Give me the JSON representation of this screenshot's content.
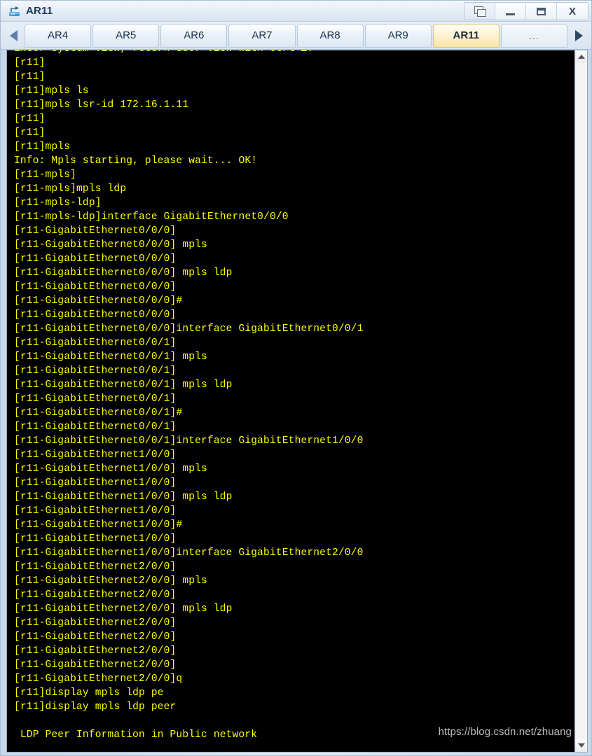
{
  "window": {
    "title": "AR11",
    "icon": "router-icon",
    "controls": [
      {
        "name": "restore-button",
        "glyph": "restore-icon",
        "label": ""
      },
      {
        "name": "minimize-button",
        "glyph": "minimize-icon",
        "label": ""
      },
      {
        "name": "maximize-button",
        "glyph": "maximize-icon",
        "label": ""
      },
      {
        "name": "close-button",
        "glyph": "close-icon",
        "label": "X"
      }
    ]
  },
  "tabbar": {
    "scroll_left_icon": "chevron-left-icon",
    "scroll_right_icon": "chevron-right-icon",
    "active_tab": "AR11",
    "tabs": [
      {
        "label": "AR4",
        "active": false
      },
      {
        "label": "AR5",
        "active": false
      },
      {
        "label": "AR6",
        "active": false
      },
      {
        "label": "AR7",
        "active": false
      },
      {
        "label": "AR8",
        "active": false
      },
      {
        "label": "AR9",
        "active": false
      },
      {
        "label": "AR11",
        "active": true
      },
      {
        "label": "...",
        "active": false
      }
    ]
  },
  "terminal": {
    "foreground_color": "#ffff00",
    "background_color": "#000000",
    "watermark": "https://blog.csdn.net/zhuang",
    "lines": [
      "Enter system view, return user view with Ctrl+Z.",
      "[r11]",
      "[r11]",
      "[r11]mpls ls",
      "[r11]mpls lsr-id 172.16.1.11",
      "[r11]",
      "[r11]",
      "[r11]mpls",
      "Info: Mpls starting, please wait... OK!",
      "[r11-mpls]",
      "[r11-mpls]mpls ldp",
      "[r11-mpls-ldp]",
      "[r11-mpls-ldp]interface GigabitEthernet0/0/0",
      "[r11-GigabitEthernet0/0/0]",
      "[r11-GigabitEthernet0/0/0] mpls",
      "[r11-GigabitEthernet0/0/0]",
      "[r11-GigabitEthernet0/0/0] mpls ldp",
      "[r11-GigabitEthernet0/0/0]",
      "[r11-GigabitEthernet0/0/0]#",
      "[r11-GigabitEthernet0/0/0]",
      "[r11-GigabitEthernet0/0/0]interface GigabitEthernet0/0/1",
      "[r11-GigabitEthernet0/0/1]",
      "[r11-GigabitEthernet0/0/1] mpls",
      "[r11-GigabitEthernet0/0/1]",
      "[r11-GigabitEthernet0/0/1] mpls ldp",
      "[r11-GigabitEthernet0/0/1]",
      "[r11-GigabitEthernet0/0/1]#",
      "[r11-GigabitEthernet0/0/1]",
      "[r11-GigabitEthernet0/0/1]interface GigabitEthernet1/0/0",
      "[r11-GigabitEthernet1/0/0]",
      "[r11-GigabitEthernet1/0/0] mpls",
      "[r11-GigabitEthernet1/0/0]",
      "[r11-GigabitEthernet1/0/0] mpls ldp",
      "[r11-GigabitEthernet1/0/0]",
      "[r11-GigabitEthernet1/0/0]#",
      "[r11-GigabitEthernet1/0/0]",
      "[r11-GigabitEthernet1/0/0]interface GigabitEthernet2/0/0",
      "[r11-GigabitEthernet2/0/0]",
      "[r11-GigabitEthernet2/0/0] mpls",
      "[r11-GigabitEthernet2/0/0]",
      "[r11-GigabitEthernet2/0/0] mpls ldp",
      "[r11-GigabitEthernet2/0/0]",
      "[r11-GigabitEthernet2/0/0]",
      "[r11-GigabitEthernet2/0/0]",
      "[r11-GigabitEthernet2/0/0]",
      "[r11-GigabitEthernet2/0/0]q",
      "[r11]display mpls ldp pe",
      "[r11]display mpls ldp peer",
      "",
      " LDP Peer Information in Public network"
    ]
  },
  "scrollbar": {
    "up_icon": "chevron-up-icon",
    "down_icon": "chevron-down-icon"
  }
}
